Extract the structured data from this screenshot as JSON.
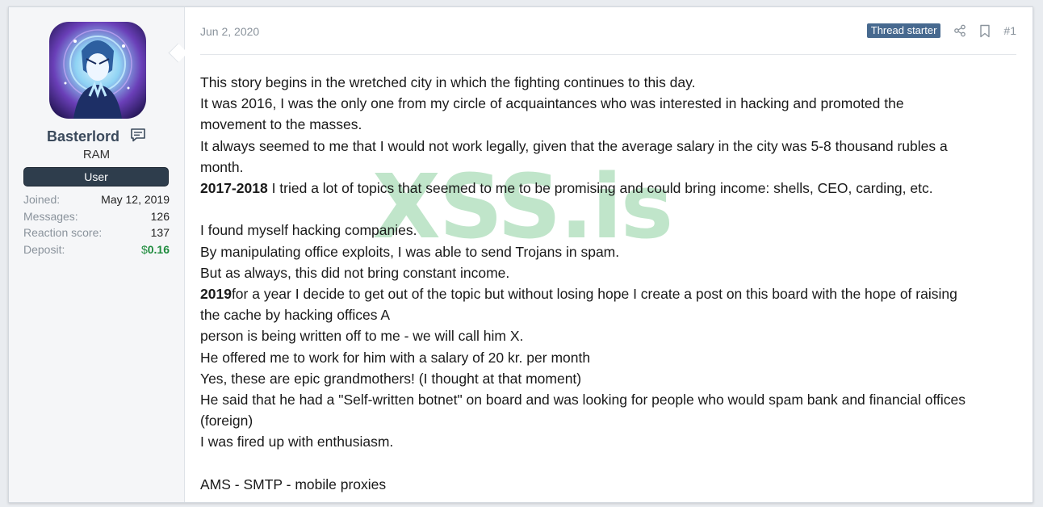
{
  "user": {
    "name": "Basterlord",
    "title": "RAM",
    "banner": "User",
    "stats": [
      {
        "label": "Joined:",
        "value": "May 12, 2019"
      },
      {
        "label": "Messages:",
        "value": "126"
      },
      {
        "label": "Reaction score:",
        "value": "137"
      }
    ],
    "deposit": {
      "label": "Deposit:",
      "currency": "$",
      "amount": "0.16"
    },
    "avatar_icon": "avatar-icon"
  },
  "post": {
    "date": "Jun 2, 2020",
    "badge": "Thread starter",
    "number": "#1",
    "watermark": "XSS.is",
    "body": {
      "l1": "This story begins in the wretched city in which the fighting continues to this day.",
      "l2": "It was 2016, I was the only one from my circle of acquaintances who was interested in hacking and promoted the",
      "l3": "movement to the masses.",
      "l4": "It always seemed to me that I would not work legally, given that the average salary in the city was 5-8 thousand rubles a",
      "l5": "month.",
      "l6_bold": "2017-2018",
      "l6_rest": " I tried a lot of topics that seemed to me to be promising and could bring income: shells, CEO, carding, etc.",
      "l7": "I found myself hacking companies.",
      "l8": "By manipulating office exploits, I was able to send Trojans in spam.",
      "l9": "But as always, this did not bring constant income.",
      "l10_bold": "2019",
      "l10_rest": "for a year I decide to get out of the topic but without losing hope I create a post on this board with the hope of raising",
      "l11": "the cache by hacking offices A",
      "l12": "person is being written off to me - we will call him X.",
      "l13": "He offered me to work for him with a salary of 20 kr. per month",
      "l14": "Yes, these are epic grandmothers! (I thought at that moment)",
      "l15": "He said that he had a \"Self-written botnet\" on board and was looking for people who would spam bank and financial offices",
      "l16": "(foreign)",
      "l17": "I was fired up with enthusiasm.",
      "l18": "AMS - SMTP - mobile proxies"
    }
  },
  "icons": {
    "message": "message-icon",
    "share": "share-icon",
    "bookmark": "bookmark-icon"
  },
  "colors": {
    "badge": "#47698f",
    "banner": "#2e3d4c",
    "deposit": "#1e8b3d",
    "watermark": "#3caf5a"
  }
}
